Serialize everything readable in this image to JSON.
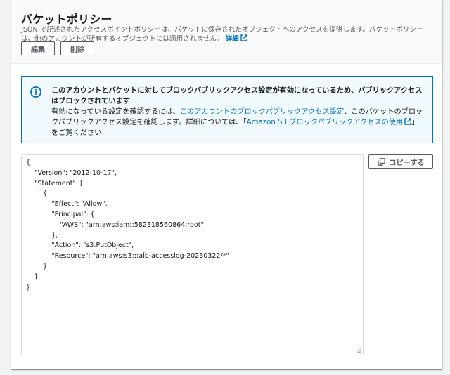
{
  "panel": {
    "title": "バケットポリシー",
    "description": "JSON で記述されたアクセスポイントポリシーは、バケットに保存されたオブジェクトへのアクセスを提供します。バケットポリシーは、他のアカウントが所有するオブジェクトには適用されません。",
    "details_link": "詳細",
    "edit_label": "編集",
    "delete_label": "削除"
  },
  "alert": {
    "title": "このアカウントとバケットに対してブロックパブリックアクセス設定が有効になっているため、パブリックアクセスはブロックされています",
    "body_prefix": "有効になっている設定を確認するには、",
    "link1": "このアカウントのブロックパブリックアクセス設定",
    "body_middle": "、このバケットのブロックパブリックアクセス設定を確認します。詳細については、「",
    "link2": "Amazon S3 ブロックパブリックアクセスの使用",
    "body_suffix": "」をご覧ください"
  },
  "policy": {
    "copy_label": "コピーする",
    "json": "{\n    \"Version\": \"2012-10-17\",\n    \"Statement\": [\n        {\n            \"Effect\": \"Allow\",\n            \"Principal\": {\n                \"AWS\": \"arn:aws:iam::582318560864:root\"\n            },\n            \"Action\": \"s3:PutObject\",\n            \"Resource\": \"arn:aws:s3:::alb-accesslog-20230322/*\"\n        }\n    ]\n}"
  },
  "colors": {
    "link": "#0073bb",
    "alert_bg": "#f1faff",
    "alert_border": "#0073bb"
  },
  "icons": {
    "info": "info-circle-icon",
    "external": "external-link-icon",
    "copy": "copy-icon"
  }
}
